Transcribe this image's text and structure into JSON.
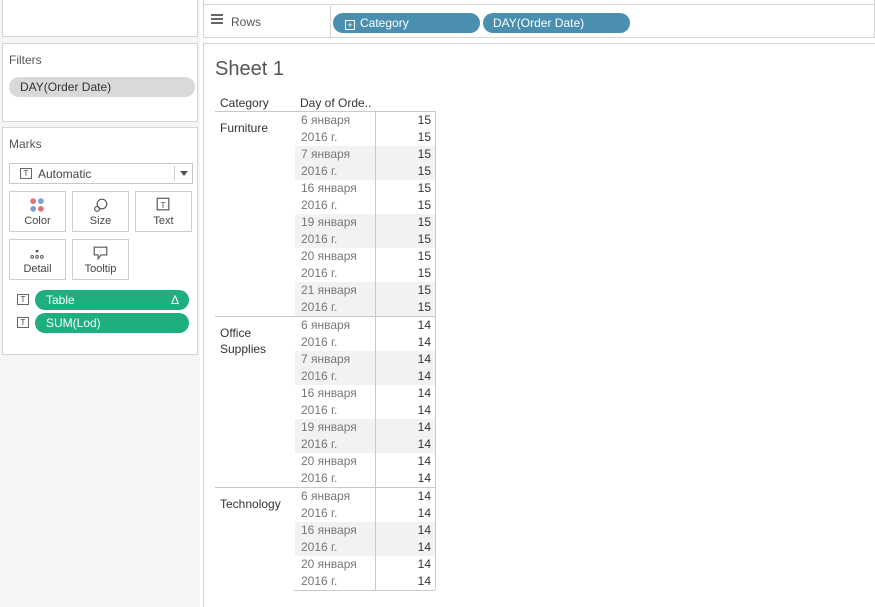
{
  "rows_shelf": {
    "label": "Rows",
    "pills": [
      "Category",
      "DAY(Order Date)"
    ]
  },
  "filters": {
    "title": "Filters",
    "items": [
      "DAY(Order Date)"
    ]
  },
  "marks": {
    "title": "Marks",
    "mark_type": "Automatic",
    "buttons": [
      "Color",
      "Size",
      "Text",
      "Detail",
      "Tooltip"
    ],
    "fields": [
      {
        "label": "Table",
        "badge": "Δ"
      },
      {
        "label": "SUM(Lod)",
        "badge": ""
      }
    ]
  },
  "sheet": {
    "title": "Sheet 1",
    "col_headers": [
      "Category",
      "Day of Orde.."
    ],
    "groups": [
      {
        "category": "Furniture",
        "rows": [
          {
            "date": "6 января",
            "value": "15"
          },
          {
            "date": "2016 г.",
            "value": "15"
          },
          {
            "date": "7 января",
            "value": "15"
          },
          {
            "date": "2016 г.",
            "value": "15"
          },
          {
            "date": "16 января",
            "value": "15"
          },
          {
            "date": "2016 г.",
            "value": "15"
          },
          {
            "date": "19 января",
            "value": "15"
          },
          {
            "date": "2016 г.",
            "value": "15"
          },
          {
            "date": "20 января",
            "value": "15"
          },
          {
            "date": "2016 г.",
            "value": "15"
          },
          {
            "date": "21 января",
            "value": "15"
          },
          {
            "date": "2016 г.",
            "value": "15"
          }
        ]
      },
      {
        "category": "Office Supplies",
        "rows": [
          {
            "date": "6 января",
            "value": "14"
          },
          {
            "date": "2016 г.",
            "value": "14"
          },
          {
            "date": "7 января",
            "value": "14"
          },
          {
            "date": "2016 г.",
            "value": "14"
          },
          {
            "date": "16 января",
            "value": "14"
          },
          {
            "date": "2016 г.",
            "value": "14"
          },
          {
            "date": "19 января",
            "value": "14"
          },
          {
            "date": "2016 г.",
            "value": "14"
          },
          {
            "date": "20 января",
            "value": "14"
          },
          {
            "date": "2016 г.",
            "value": "14"
          }
        ]
      },
      {
        "category": "Technology",
        "rows": [
          {
            "date": "6 января",
            "value": "14"
          },
          {
            "date": "2016 г.",
            "value": "14"
          },
          {
            "date": "16 января",
            "value": "14"
          },
          {
            "date": "2016 г.",
            "value": "14"
          },
          {
            "date": "20 января",
            "value": "14"
          },
          {
            "date": "2016 г.",
            "value": "14"
          }
        ]
      }
    ]
  },
  "colors": {
    "dimension_pill": "#4b8fb0",
    "measure_pill": "#1fae7e",
    "filter_pill": "#d9d9d9"
  }
}
